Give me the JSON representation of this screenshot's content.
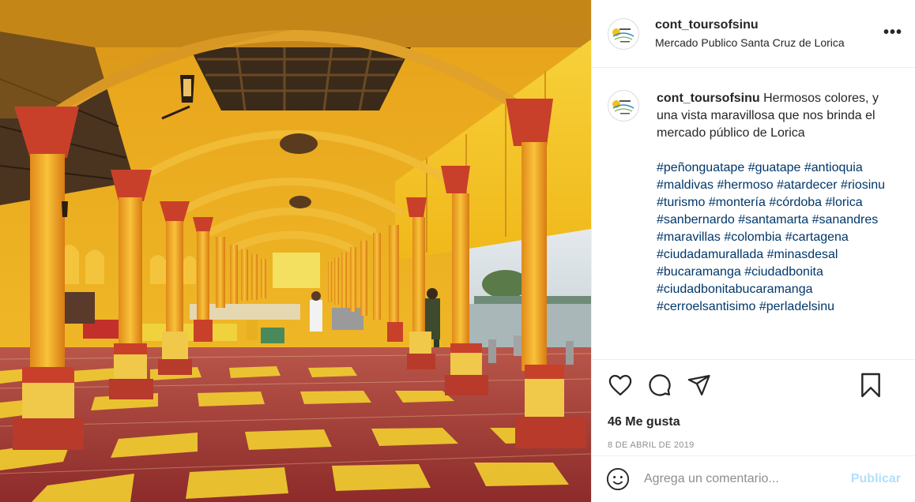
{
  "post": {
    "photo_alt": "",
    "header": {
      "username": "cont_toursofsinu",
      "location": "Mercado Publico Santa Cruz de Lorica",
      "more_label": "•••"
    },
    "caption": {
      "username": "cont_toursofsinu",
      "text": "Hermosos colores, y una vista maravillosa que nos brinda el mercado público de Lorica",
      "hashtags": [
        "#peñonguatape",
        "#guatape",
        "#antioquia",
        "#maldivas",
        "#hermoso",
        "#atardecer",
        "#riosinu",
        "#turismo",
        "#montería",
        "#córdoba",
        "#lorica",
        "#sanbernardo",
        "#santamarta",
        "#sanandres",
        "#maravillas",
        "#colombia",
        "#cartagena",
        "#ciudadamurallada",
        "#minasdesal",
        "#bucaramanga",
        "#ciudadbonita",
        "#ciudadbonitabucaramanga",
        "#cerroelsantisimo",
        "#perladelsinu"
      ]
    },
    "actions": {
      "icons": [
        "heart-icon",
        "comment-icon",
        "share-icon",
        "bookmark-icon"
      ],
      "likes": "46 Me gusta",
      "date": "8 DE ABRIL DE 2019"
    },
    "comment_box": {
      "placeholder": "Agrega un comentario...",
      "post_label": "Publicar",
      "post_color": "#b2dffc"
    }
  }
}
